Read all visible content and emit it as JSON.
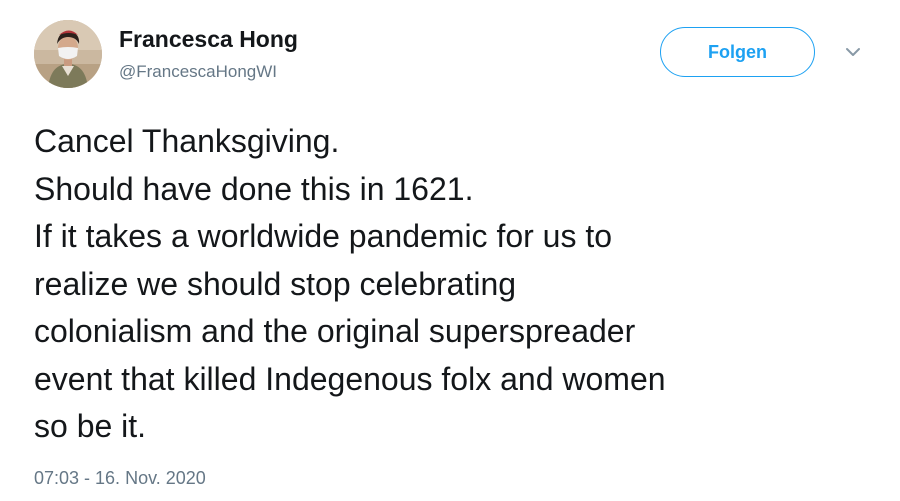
{
  "author": {
    "display_name": "Francesca Hong",
    "handle": "@FrancescaHongWI"
  },
  "follow_button": {
    "label": "Folgen"
  },
  "tweet": {
    "lines": [
      "Cancel Thanksgiving.",
      "Should have done this in 1621.",
      "If it takes a worldwide pandemic for us to",
      "realize we should stop celebrating",
      "colonialism and the original superspreader",
      "event that killed Indegenous folx and women",
      "so be it."
    ],
    "timestamp": "07:03 - 16. Nov. 2020"
  },
  "icons": {
    "avatar": "profile-photo",
    "menu": "chevron-down-icon"
  },
  "colors": {
    "accent": "#1da1f2",
    "text": "#14171a",
    "secondary_text": "#657786"
  }
}
